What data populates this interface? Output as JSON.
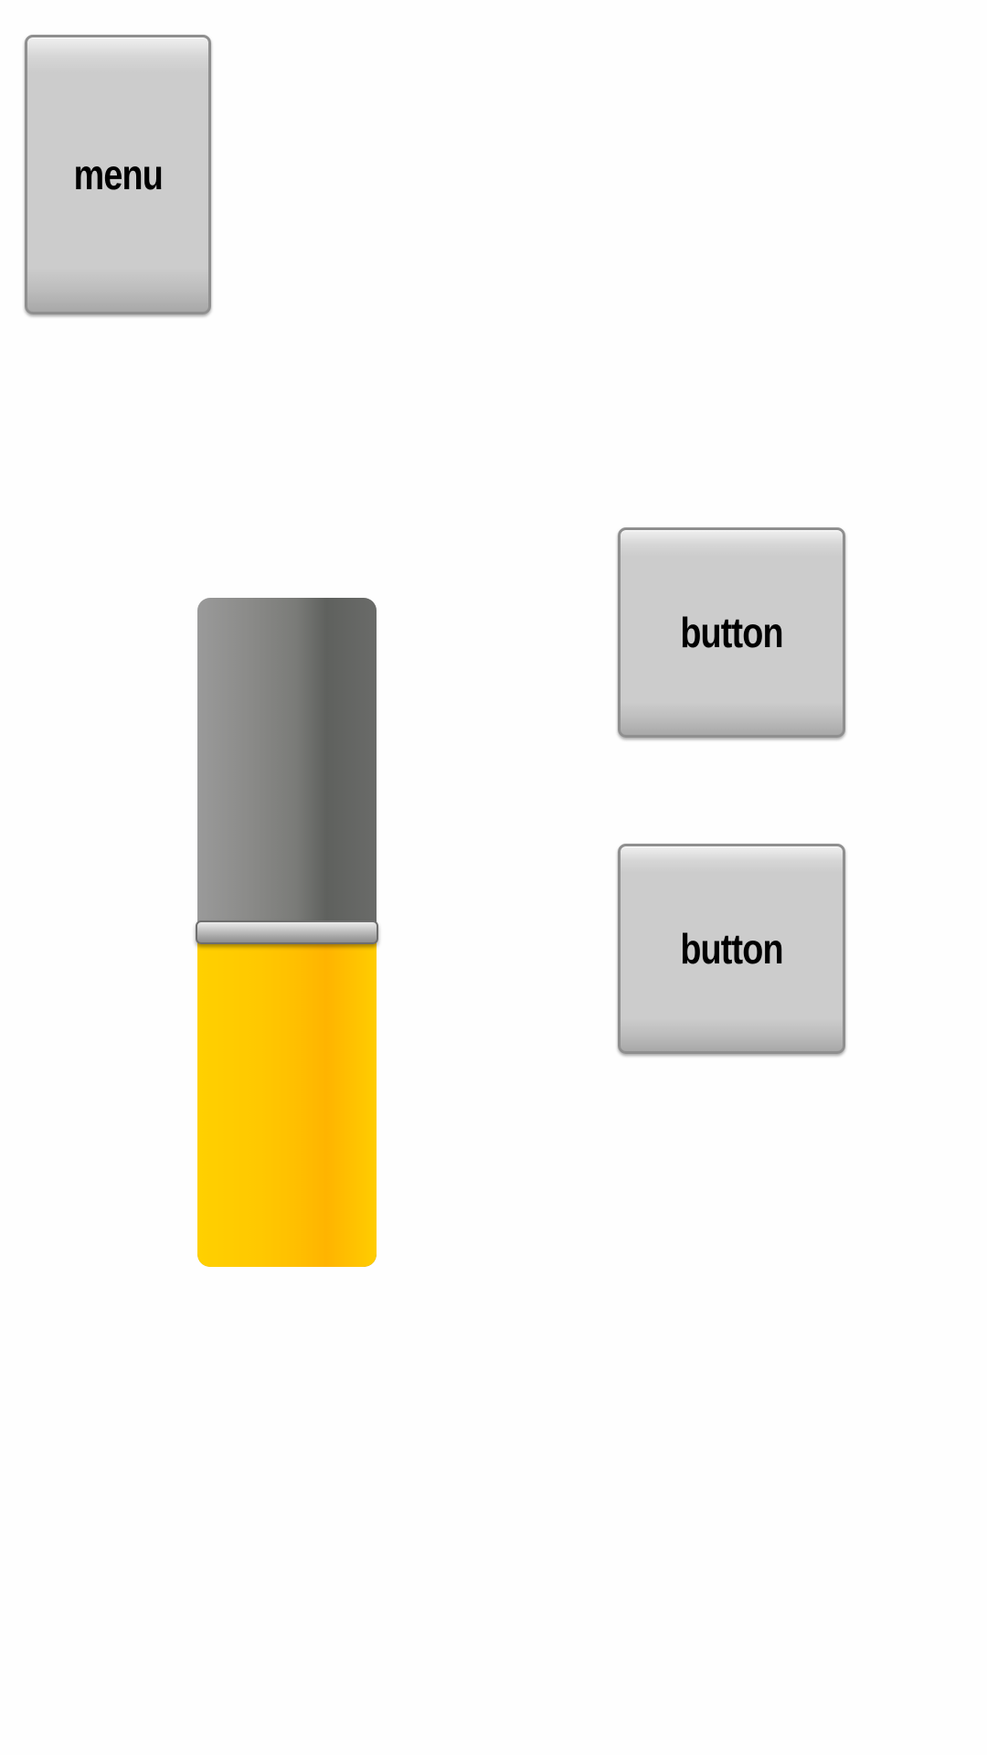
{
  "menu": {
    "label": "menu"
  },
  "buttons": [
    {
      "label": "button"
    },
    {
      "label": "button"
    }
  ],
  "slider": {
    "value": 0.5,
    "track_color": "#7a7b78",
    "fill_color": "#ffbf00"
  }
}
